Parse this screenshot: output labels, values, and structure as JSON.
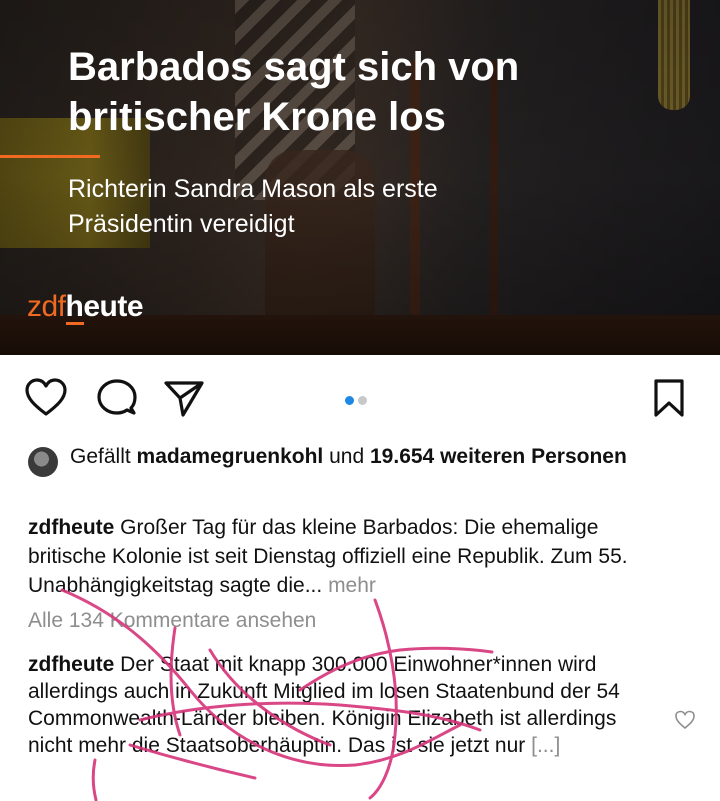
{
  "post_image": {
    "headline": "Barbados sagt sich von britischer Krone los",
    "subheadline": "Richterin Sandra Mason als erste Präsidentin vereidigt",
    "logo_zdf": "zdf",
    "logo_heute": "heute"
  },
  "actions": {
    "icons": [
      "heart-icon",
      "comment-icon",
      "share-icon",
      "bookmark-icon"
    ],
    "carousel_active_index": 0,
    "carousel_count": 2,
    "colors": {
      "active_dot": "#1e88e5",
      "inactive_dot": "#c8c8c8"
    }
  },
  "likes": {
    "prefix": "Gefällt",
    "user": "madamegruenkohl",
    "middle": "und",
    "count": "19.654 weiteren",
    "suffix": "Personen"
  },
  "caption": {
    "username": "zdfheute",
    "text": "Großer Tag für das kleine Barbados: Die ehemalige britische Kolonie ist seit Dienstag offiziell eine Republik. Zum 55. Unabhängigkeitstag sagte die...",
    "more": "mehr"
  },
  "view_comments": "Alle 134 Kommentare ansehen",
  "comment": {
    "username": "zdfheute",
    "text": "Der Staat mit knapp 300.000 Einwohner*innen wird allerdings auch in Zukunft Mitglied im losen Staatenbund der 54 Commonwealth-Länder bleiben. Königin Elizabeth ist allerdings nicht mehr die Staatsoberhäuptin. Das ist sie jetzt nur",
    "ellipsis": "[...]"
  },
  "theme": {
    "accent_orange": "#f26a21",
    "annotation_pink": "#d6347a",
    "muted_text": "#8e8e8e"
  }
}
